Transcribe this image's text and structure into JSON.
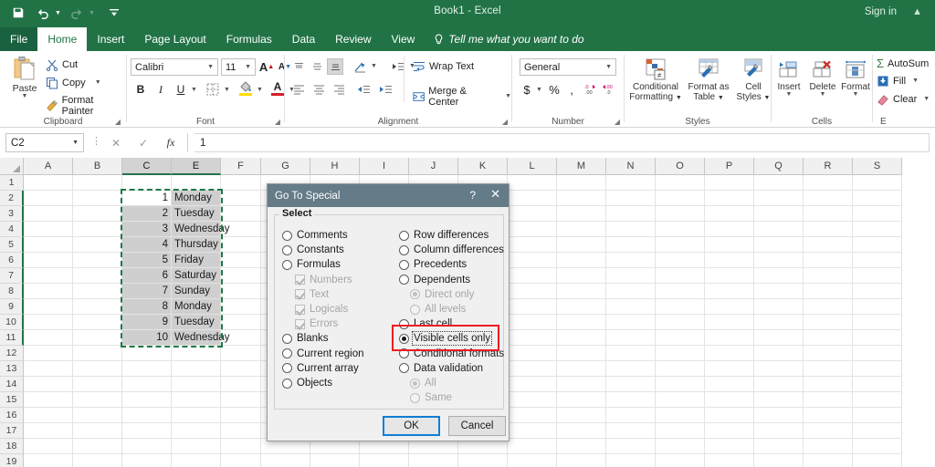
{
  "window": {
    "title": "Book1  -  Excel",
    "sign_in": "Sign in",
    "quick_access": [
      {
        "name": "save-icon",
        "label": "Save"
      },
      {
        "name": "undo-icon",
        "label": "Undo"
      },
      {
        "name": "redo-icon",
        "label": "Redo"
      },
      {
        "name": "customize-qat-icon",
        "label": "Customize Quick Access Toolbar"
      }
    ]
  },
  "tabs": [
    {
      "label": "File",
      "active": false
    },
    {
      "label": "Home",
      "active": true
    },
    {
      "label": "Insert",
      "active": false
    },
    {
      "label": "Page Layout",
      "active": false
    },
    {
      "label": "Formulas",
      "active": false
    },
    {
      "label": "Data",
      "active": false
    },
    {
      "label": "Review",
      "active": false
    },
    {
      "label": "View",
      "active": false
    }
  ],
  "tellme": {
    "placeholder": "Tell me what you want to do"
  },
  "ribbon": {
    "clipboard": {
      "label": "Clipboard",
      "paste": "Paste",
      "cut": "Cut",
      "copy": "Copy",
      "format_painter": "Format Painter"
    },
    "font": {
      "label": "Font",
      "family": "Calibri",
      "size": "11",
      "grow": "A",
      "shrink": "A",
      "bold": "B",
      "italic": "I",
      "underline": "U",
      "borders": "Borders",
      "fill_color": "A",
      "font_color": "A"
    },
    "alignment": {
      "label": "Alignment",
      "wrap_text": "Wrap Text",
      "merge_center": "Merge & Center"
    },
    "number": {
      "label": "Number",
      "format": "General",
      "currency": "$",
      "percent": "%",
      "comma": ",",
      "increase_decimal": ".00",
      "decrease_decimal": ".00"
    },
    "styles": {
      "label": "Styles",
      "conditional_formatting": "Conditional\nFormatting",
      "conditional_formatting_l1": "Conditional",
      "conditional_formatting_l2": "Formatting",
      "format_as_table_l1": "Format as",
      "format_as_table_l2": "Table",
      "cell_styles_l1": "Cell",
      "cell_styles_l2": "Styles"
    },
    "cells": {
      "label": "Cells",
      "insert": "Insert",
      "delete": "Delete",
      "format": "Format"
    },
    "editing": {
      "label": "E",
      "autosum": "AutoSum",
      "fill": "Fill",
      "clear": "Clear"
    }
  },
  "formula_bar": {
    "name_box": "C2",
    "cancel": "cancel-icon",
    "enter": "enter-icon",
    "insert_function": "fx",
    "value": "1"
  },
  "grid": {
    "columns": [
      "A",
      "B",
      "C",
      "E",
      "F",
      "G",
      "H",
      "I",
      "J",
      "K",
      "L",
      "M",
      "N",
      "O",
      "P",
      "Q",
      "R",
      "S"
    ],
    "selected_columns": [
      "C",
      "E"
    ],
    "rows": [
      "1",
      "2",
      "3",
      "4",
      "5",
      "6",
      "7",
      "8",
      "9",
      "10",
      "11",
      "12",
      "13",
      "14",
      "15",
      "16",
      "17",
      "18",
      "19"
    ],
    "selected_rows": [
      "2",
      "3",
      "4",
      "5",
      "6",
      "7",
      "8",
      "9",
      "10",
      "11"
    ],
    "data": [
      {
        "row": "2",
        "c": "1",
        "e": "Monday"
      },
      {
        "row": "3",
        "c": "2",
        "e": "Tuesday"
      },
      {
        "row": "4",
        "c": "3",
        "e": "Wednesday"
      },
      {
        "row": "5",
        "c": "4",
        "e": "Thursday"
      },
      {
        "row": "6",
        "c": "5",
        "e": "Friday"
      },
      {
        "row": "7",
        "c": "6",
        "e": "Saturday"
      },
      {
        "row": "8",
        "c": "7",
        "e": "Sunday"
      },
      {
        "row": "9",
        "c": "8",
        "e": "Monday"
      },
      {
        "row": "10",
        "c": "9",
        "e": "Tuesday"
      },
      {
        "row": "11",
        "c": "10",
        "e": "Wednesday"
      }
    ],
    "active_cell": "C2"
  },
  "dialog": {
    "title": "Go To Special",
    "help": "?",
    "close": "✕",
    "group_legend": "Select",
    "left_options": [
      {
        "label": "Comments",
        "type": "radio",
        "checked": false,
        "disabled": false
      },
      {
        "label": "Constants",
        "type": "radio",
        "checked": false,
        "disabled": false
      },
      {
        "label": "Formulas",
        "type": "radio",
        "checked": false,
        "disabled": false
      },
      {
        "label": "Numbers",
        "type": "checkbox",
        "checked": true,
        "disabled": true
      },
      {
        "label": "Text",
        "type": "checkbox",
        "checked": true,
        "disabled": true
      },
      {
        "label": "Logicals",
        "type": "checkbox",
        "checked": true,
        "disabled": true
      },
      {
        "label": "Errors",
        "type": "checkbox",
        "checked": true,
        "disabled": true
      },
      {
        "label": "Blanks",
        "type": "radio",
        "checked": false,
        "disabled": false
      },
      {
        "label": "Current region",
        "type": "radio",
        "checked": false,
        "disabled": false
      },
      {
        "label": "Current array",
        "type": "radio",
        "checked": false,
        "disabled": false
      },
      {
        "label": "Objects",
        "type": "radio",
        "checked": false,
        "disabled": false
      }
    ],
    "right_options": [
      {
        "label": "Row differences",
        "type": "radio",
        "checked": false,
        "disabled": false
      },
      {
        "label": "Column differences",
        "type": "radio",
        "checked": false,
        "disabled": false
      },
      {
        "label": "Precedents",
        "type": "radio",
        "checked": false,
        "disabled": false
      },
      {
        "label": "Dependents",
        "type": "radio",
        "checked": false,
        "disabled": false
      },
      {
        "label": "Direct only",
        "type": "radio",
        "checked": true,
        "disabled": true
      },
      {
        "label": "All levels",
        "type": "radio",
        "checked": false,
        "disabled": true
      },
      {
        "label": "Last cell",
        "type": "radio",
        "checked": false,
        "disabled": false
      },
      {
        "label": "Visible cells only",
        "type": "radio",
        "checked": true,
        "disabled": false
      },
      {
        "label": "Conditional formats",
        "type": "radio",
        "checked": false,
        "disabled": false
      },
      {
        "label": "Data validation",
        "type": "radio",
        "checked": false,
        "disabled": false
      },
      {
        "label": "All",
        "type": "radio",
        "checked": true,
        "disabled": true
      },
      {
        "label": "Same",
        "type": "radio",
        "checked": false,
        "disabled": true
      }
    ],
    "ok": "OK",
    "cancel": "Cancel",
    "highlight_color": "#ee1c25"
  },
  "colors": {
    "excel_green": "#217346",
    "dialog_title": "#647b88",
    "selection_green": "#1f7a45",
    "focus_blue": "#0f7fd4"
  }
}
